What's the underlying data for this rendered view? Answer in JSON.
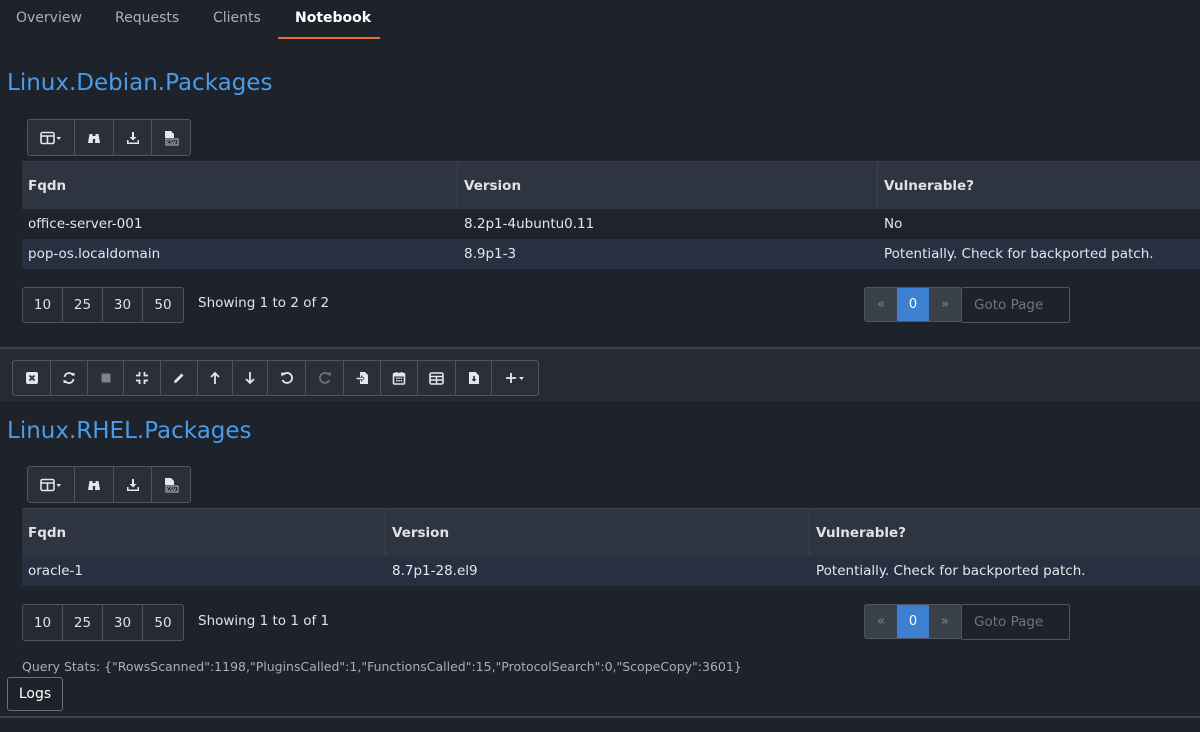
{
  "tabs": [
    {
      "label": "Overview"
    },
    {
      "label": "Requests"
    },
    {
      "label": "Clients"
    },
    {
      "label": "Notebook"
    }
  ],
  "active_tab": "Notebook",
  "sections": [
    {
      "title": "Linux.Debian.Packages",
      "columns": [
        "Fqdn",
        "Version",
        "Vulnerable?"
      ],
      "rows": [
        {
          "fqdn": "office-server-001",
          "version": "8.2p1-4ubuntu0.11",
          "vulnerable": "No"
        },
        {
          "fqdn": "pop-os.localdomain",
          "version": "8.9p1-3",
          "vulnerable": "Potentially. Check for backported patch."
        }
      ],
      "page_sizes": [
        "10",
        "25",
        "30",
        "50"
      ],
      "showing": "Showing 1 to 2 of 2",
      "pager": {
        "prev": "«",
        "current": "0",
        "next": "»"
      },
      "goto_placeholder": "Goto Page"
    },
    {
      "title": "Linux.RHEL.Packages",
      "columns": [
        "Fqdn",
        "Version",
        "Vulnerable?"
      ],
      "rows": [
        {
          "fqdn": "oracle-1",
          "version": "8.7p1-28.el9",
          "vulnerable": "Potentially. Check for backported patch."
        }
      ],
      "page_sizes": [
        "10",
        "25",
        "30",
        "50"
      ],
      "showing": "Showing 1 to 1 of 1",
      "pager": {
        "prev": "«",
        "current": "0",
        "next": "»"
      },
      "goto_placeholder": "Goto Page"
    }
  ],
  "table_toolbar_icons": [
    "column-select-icon",
    "binoculars-icon",
    "download-icon",
    "csv-icon"
  ],
  "notebook_toolbar_icons": [
    "close-cell-icon",
    "refresh-icon",
    "stop-icon",
    "collapse-icon",
    "edit-icon",
    "move-up-icon",
    "move-down-icon",
    "undo-icon",
    "redo-icon",
    "export-icon",
    "calendar-icon",
    "table-icon",
    "download-file-icon",
    "add-cell-icon"
  ],
  "query_stats": "Query Stats: {\"RowsScanned\":1198,\"PluginsCalled\":1,\"FunctionsCalled\":15,\"ProtocolSearch\":0,\"ScopeCopy\":3601}",
  "logs_label": "Logs",
  "colors": {
    "background": "#1e222a",
    "title_blue": "#4a9be8",
    "tab_underline": "#e0703a",
    "pager_active": "#3d7fd1"
  }
}
